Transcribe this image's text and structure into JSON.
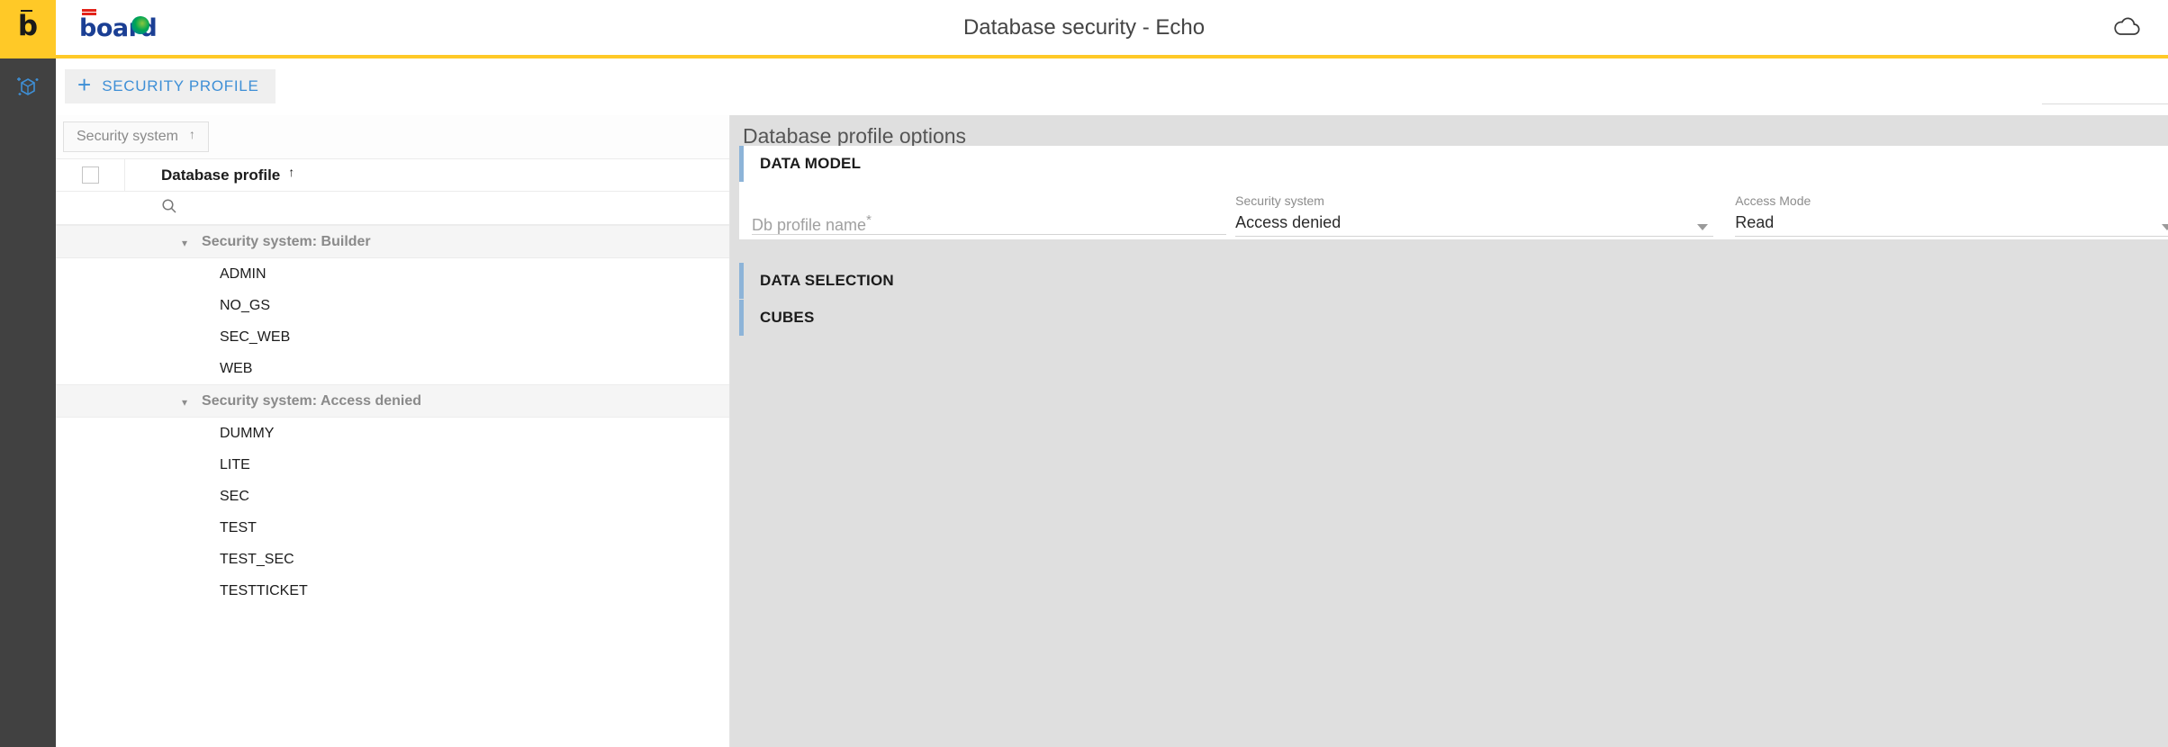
{
  "header": {
    "title": "Database security - Echo",
    "brand_letter": "b",
    "logo_text": "board",
    "cloud_icon": "cloud-icon"
  },
  "rail": {
    "icon": "data-model-cube-icon"
  },
  "toolbar": {
    "add_label": "SECURITY PROFILE",
    "add_plus": "+"
  },
  "list": {
    "filter_chip": {
      "label": "Security system",
      "sort_arrow": "↑"
    },
    "column_header": {
      "label": "Database profile",
      "sort_arrow": "↑"
    },
    "search_icon": "search-icon",
    "groups": [
      {
        "label": "Security system: Builder",
        "caret": "▾",
        "items": [
          "ADMIN",
          "NO_GS",
          "SEC_WEB",
          "WEB"
        ]
      },
      {
        "label": "Security system: Access denied",
        "caret": "▾",
        "items": [
          "DUMMY",
          "LITE",
          "SEC",
          "TEST",
          "TEST_SEC",
          "TESTTICKET"
        ]
      }
    ]
  },
  "detail": {
    "title": "Database profile options",
    "sections": {
      "data_model": {
        "title": "DATA MODEL",
        "fields": {
          "db_profile_name": {
            "label": "",
            "placeholder": "Db profile name",
            "required_mark": "*",
            "value": ""
          },
          "security_system": {
            "label": "Security system",
            "value": "Access denied"
          },
          "access_mode": {
            "label": "Access Mode",
            "value": "Read"
          }
        }
      },
      "data_selection": {
        "title": "DATA SELECTION"
      },
      "cubes": {
        "title": "CUBES"
      }
    }
  },
  "colors": {
    "brand_yellow": "#FFC927",
    "rail_dark": "#414141",
    "accent_blue": "#3e8fd6",
    "section_bar": "#8db4d8",
    "panel_bg": "#dfdfdf"
  }
}
